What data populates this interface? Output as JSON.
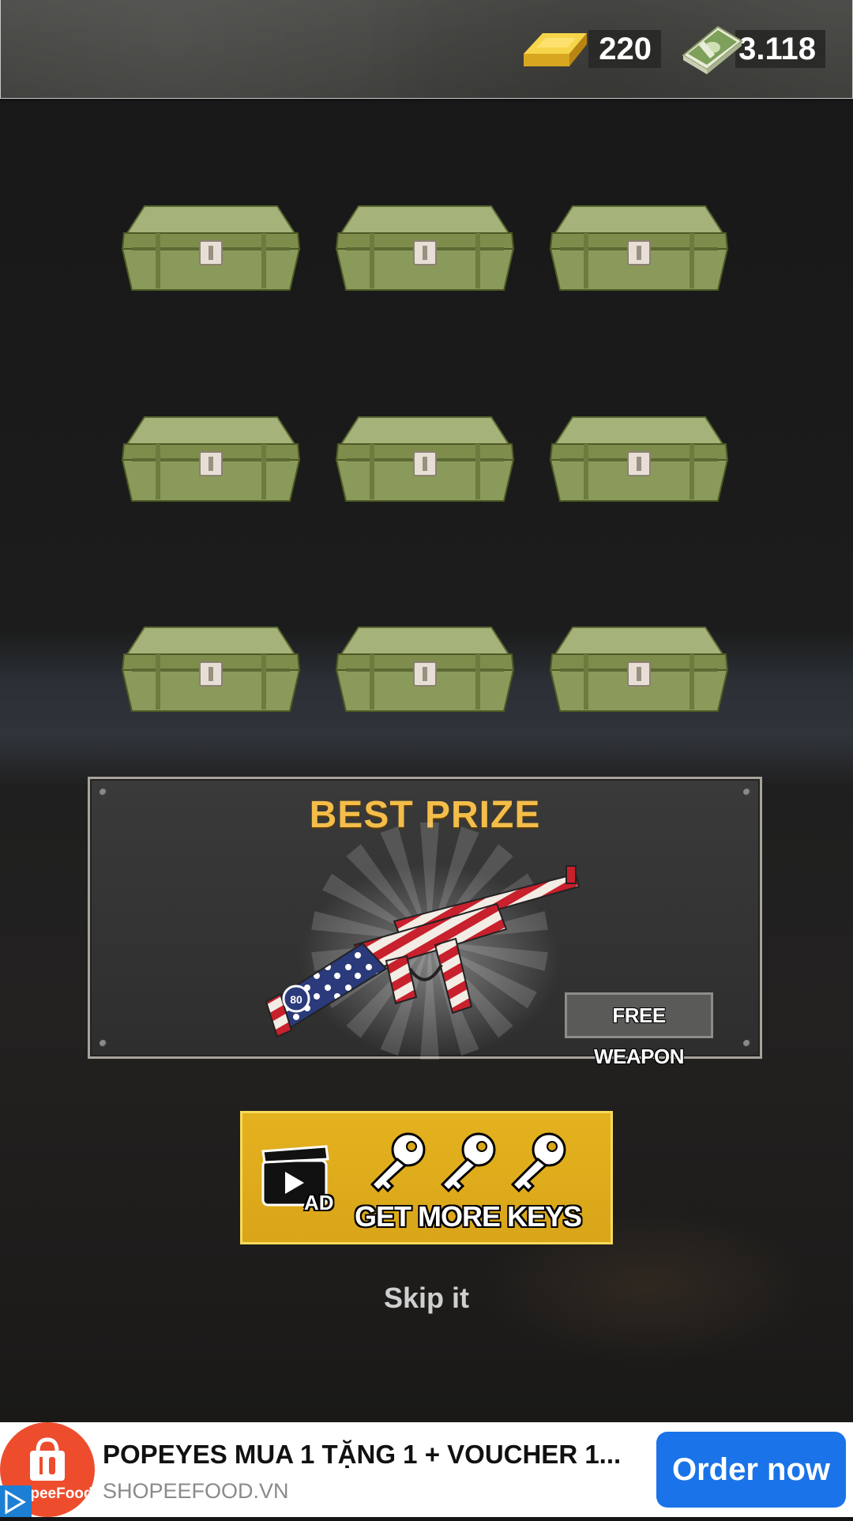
{
  "hud": {
    "gold_value": "220",
    "cash_value": "3.118",
    "gold_icon": "gold-bar-icon",
    "cash_icon": "cash-stack-icon"
  },
  "chests": {
    "count": 9,
    "icon": "locked-chest-icon",
    "color": "#8a9a5b"
  },
  "prize": {
    "title": "BEST PRIZE",
    "badge": "FREE WEAPON",
    "weapon_icon": "flag-themed-submachine-gun-icon",
    "weapon_badge_text": "80"
  },
  "keys_button": {
    "ad_badge": "AD",
    "label": "GET MORE KEYS",
    "key_icon": "key-icon",
    "keys_shown": 3
  },
  "skip_label": "Skip it",
  "ad_banner": {
    "logo_text": "ShopeeFood",
    "title": "POPEYES MUA 1 TẶNG 1 + VOUCHER 1...",
    "domain": "SHOPEEFOOD.VN",
    "cta": "Order now"
  },
  "colors": {
    "prize_title": "#f4bd4a",
    "keys_button": "#e0ab1d",
    "ad_cta": "#1a73e8",
    "ad_logo": "#ee4d2d"
  }
}
